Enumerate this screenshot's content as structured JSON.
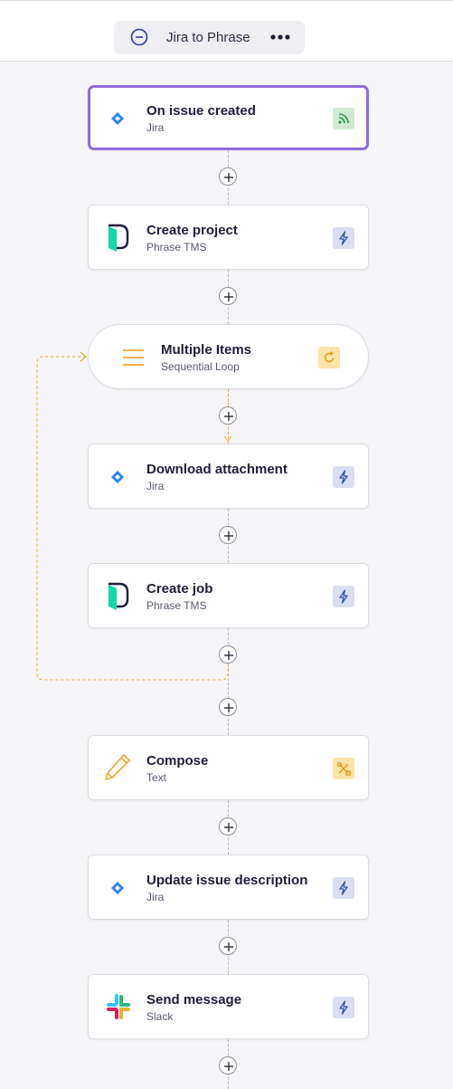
{
  "header": {
    "flow_title": "Jira to Phrase",
    "collapse_icon": "minus-circle-icon",
    "more_icon": "more-dots-icon"
  },
  "colors": {
    "selected_border": "#8f6dd9",
    "loop_accent": "#f0a830",
    "trigger_badge_bg": "#cfe9d3",
    "action_badge_bg": "#d9def3",
    "loop_badge_bg": "#fde3a7",
    "compose_badge_bg": "#fde3a7"
  },
  "steps": [
    {
      "title": "On issue created",
      "subtitle": "Jira",
      "icon": "jira-icon",
      "badge": "trigger-feed-icon",
      "selected": true
    },
    {
      "title": "Create project",
      "subtitle": "Phrase TMS",
      "icon": "phrase-tms-icon",
      "badge": "lightning-icon"
    },
    {
      "title": "Multiple Items",
      "subtitle": "Sequential Loop",
      "icon": "list-lines-icon",
      "badge": "loop-refresh-icon"
    },
    {
      "title": "Download attachment",
      "subtitle": "Jira",
      "icon": "jira-icon",
      "badge": "lightning-icon"
    },
    {
      "title": "Create job",
      "subtitle": "Phrase TMS",
      "icon": "phrase-tms-icon",
      "badge": "lightning-icon"
    },
    {
      "title": "Compose",
      "subtitle": "Text",
      "icon": "pencil-icon",
      "badge": "tools-icon"
    },
    {
      "title": "Update issue description",
      "subtitle": "Jira",
      "icon": "jira-icon",
      "badge": "lightning-icon"
    },
    {
      "title": "Send message",
      "subtitle": "Slack",
      "icon": "slack-icon",
      "badge": "lightning-icon"
    }
  ]
}
